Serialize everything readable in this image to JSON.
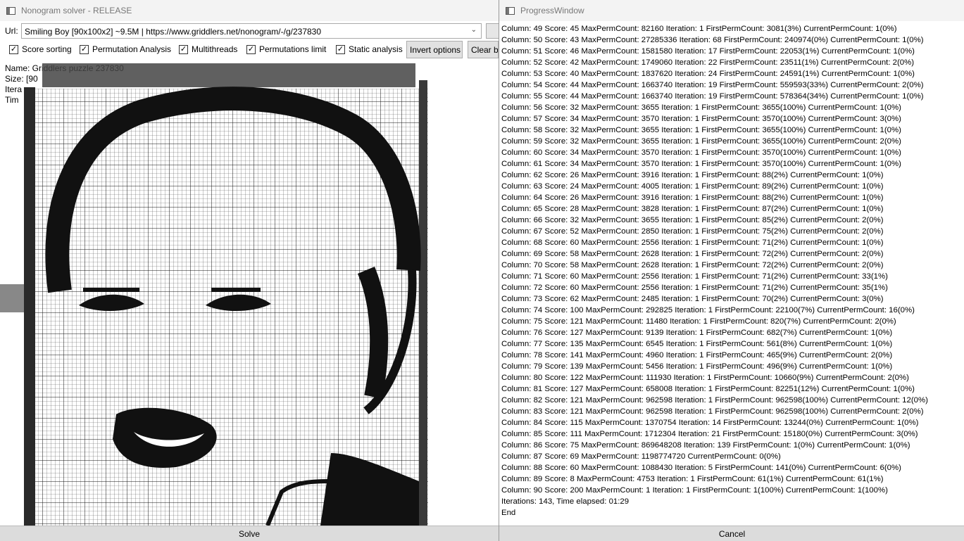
{
  "main_window": {
    "title": "Nonogram solver - RELEASE",
    "url_label": "Url:",
    "url_value": "Smiling Boy [90x100x2] ~9.5M | https://www.griddlers.net/nonogram/-/g/237830",
    "options": [
      {
        "label": "Score sorting",
        "checked": true
      },
      {
        "label": "Permutation Analysis",
        "checked": true
      },
      {
        "label": "Multithreads",
        "checked": true
      },
      {
        "label": "Permutations limit",
        "checked": true
      },
      {
        "label": "Static analysis",
        "checked": true
      }
    ],
    "invert_button": "Invert options",
    "clear_button": "Clear bo",
    "info_lines": [
      "Name: Griddlers puzzle 237830",
      "Size: [90",
      "Itera",
      "Tim"
    ],
    "solve_button": "Solve"
  },
  "progress_window": {
    "title": "ProgressWindow",
    "log_lines": [
      "Column: 49 Score: 45 MaxPermCount: 82160 Iteration: 1 FirstPermCount: 3081(3%) CurrentPermCount: 1(0%)",
      "Column: 50 Score: 43 MaxPermCount: 27285336 Iteration: 68 FirstPermCount: 240974(0%) CurrentPermCount: 1(0%)",
      "Column: 51 Score: 46 MaxPermCount: 1581580 Iteration: 17 FirstPermCount: 22053(1%) CurrentPermCount: 1(0%)",
      "Column: 52 Score: 42 MaxPermCount: 1749060 Iteration: 22 FirstPermCount: 23511(1%) CurrentPermCount: 2(0%)",
      "Column: 53 Score: 40 MaxPermCount: 1837620 Iteration: 24 FirstPermCount: 24591(1%) CurrentPermCount: 1(0%)",
      "Column: 54 Score: 44 MaxPermCount: 1663740 Iteration: 19 FirstPermCount: 559593(33%) CurrentPermCount: 2(0%)",
      "Column: 55 Score: 44 MaxPermCount: 1663740 Iteration: 19 FirstPermCount: 578364(34%) CurrentPermCount: 1(0%)",
      "Column: 56 Score: 32 MaxPermCount: 3655 Iteration: 1 FirstPermCount: 3655(100%) CurrentPermCount: 1(0%)",
      "Column: 57 Score: 34 MaxPermCount: 3570 Iteration: 1 FirstPermCount: 3570(100%) CurrentPermCount: 3(0%)",
      "Column: 58 Score: 32 MaxPermCount: 3655 Iteration: 1 FirstPermCount: 3655(100%) CurrentPermCount: 1(0%)",
      "Column: 59 Score: 32 MaxPermCount: 3655 Iteration: 1 FirstPermCount: 3655(100%) CurrentPermCount: 2(0%)",
      "Column: 60 Score: 34 MaxPermCount: 3570 Iteration: 1 FirstPermCount: 3570(100%) CurrentPermCount: 1(0%)",
      "Column: 61 Score: 34 MaxPermCount: 3570 Iteration: 1 FirstPermCount: 3570(100%) CurrentPermCount: 1(0%)",
      "Column: 62 Score: 26 MaxPermCount: 3916 Iteration: 1 FirstPermCount: 88(2%) CurrentPermCount: 1(0%)",
      "Column: 63 Score: 24 MaxPermCount: 4005 Iteration: 1 FirstPermCount: 89(2%) CurrentPermCount: 1(0%)",
      "Column: 64 Score: 26 MaxPermCount: 3916 Iteration: 1 FirstPermCount: 88(2%) CurrentPermCount: 1(0%)",
      "Column: 65 Score: 28 MaxPermCount: 3828 Iteration: 1 FirstPermCount: 87(2%) CurrentPermCount: 1(0%)",
      "Column: 66 Score: 32 MaxPermCount: 3655 Iteration: 1 FirstPermCount: 85(2%) CurrentPermCount: 2(0%)",
      "Column: 67 Score: 52 MaxPermCount: 2850 Iteration: 1 FirstPermCount: 75(2%) CurrentPermCount: 2(0%)",
      "Column: 68 Score: 60 MaxPermCount: 2556 Iteration: 1 FirstPermCount: 71(2%) CurrentPermCount: 1(0%)",
      "Column: 69 Score: 58 MaxPermCount: 2628 Iteration: 1 FirstPermCount: 72(2%) CurrentPermCount: 2(0%)",
      "Column: 70 Score: 58 MaxPermCount: 2628 Iteration: 1 FirstPermCount: 72(2%) CurrentPermCount: 2(0%)",
      "Column: 71 Score: 60 MaxPermCount: 2556 Iteration: 1 FirstPermCount: 71(2%) CurrentPermCount: 33(1%)",
      "Column: 72 Score: 60 MaxPermCount: 2556 Iteration: 1 FirstPermCount: 71(2%) CurrentPermCount: 35(1%)",
      "Column: 73 Score: 62 MaxPermCount: 2485 Iteration: 1 FirstPermCount: 70(2%) CurrentPermCount: 3(0%)",
      "Column: 74 Score: 100 MaxPermCount: 292825 Iteration: 1 FirstPermCount: 22100(7%) CurrentPermCount: 16(0%)",
      "Column: 75 Score: 121 MaxPermCount: 11480 Iteration: 1 FirstPermCount: 820(7%) CurrentPermCount: 2(0%)",
      "Column: 76 Score: 127 MaxPermCount: 9139 Iteration: 1 FirstPermCount: 682(7%) CurrentPermCount: 1(0%)",
      "Column: 77 Score: 135 MaxPermCount: 6545 Iteration: 1 FirstPermCount: 561(8%) CurrentPermCount: 1(0%)",
      "Column: 78 Score: 141 MaxPermCount: 4960 Iteration: 1 FirstPermCount: 465(9%) CurrentPermCount: 2(0%)",
      "Column: 79 Score: 139 MaxPermCount: 5456 Iteration: 1 FirstPermCount: 496(9%) CurrentPermCount: 1(0%)",
      "Column: 80 Score: 122 MaxPermCount: 111930 Iteration: 1 FirstPermCount: 10660(9%) CurrentPermCount: 2(0%)",
      "Column: 81 Score: 127 MaxPermCount: 658008 Iteration: 1 FirstPermCount: 82251(12%) CurrentPermCount: 1(0%)",
      "Column: 82 Score: 121 MaxPermCount: 962598 Iteration: 1 FirstPermCount: 962598(100%) CurrentPermCount: 12(0%)",
      "Column: 83 Score: 121 MaxPermCount: 962598 Iteration: 1 FirstPermCount: 962598(100%) CurrentPermCount: 2(0%)",
      "Column: 84 Score: 115 MaxPermCount: 1370754 Iteration: 14 FirstPermCount: 13244(0%) CurrentPermCount: 1(0%)",
      "Column: 85 Score: 111 MaxPermCount: 1712304 Iteration: 21 FirstPermCount: 15180(0%) CurrentPermCount: 3(0%)",
      "Column: 86 Score: 75 MaxPermCount: 869648208 Iteration: 139 FirstPermCount: 1(0%) CurrentPermCount: 1(0%)",
      "Column: 87 Score: 69 MaxPermCount: 1198774720 CurrentPermCount: 0(0%)",
      "Column: 88 Score: 60 MaxPermCount: 1088430 Iteration: 5 FirstPermCount: 141(0%) CurrentPermCount: 6(0%)",
      "Column: 89 Score: 8 MaxPermCount: 4753 Iteration: 1 FirstPermCount: 61(1%) CurrentPermCount: 61(1%)",
      "Column: 90 Score: 200 MaxPermCount: 1 Iteration: 1 FirstPermCount: 1(100%) CurrentPermCount: 1(100%)",
      "Iterations: 143, Time elapsed: 01:29",
      "End"
    ],
    "cancel_button": "Cancel"
  }
}
